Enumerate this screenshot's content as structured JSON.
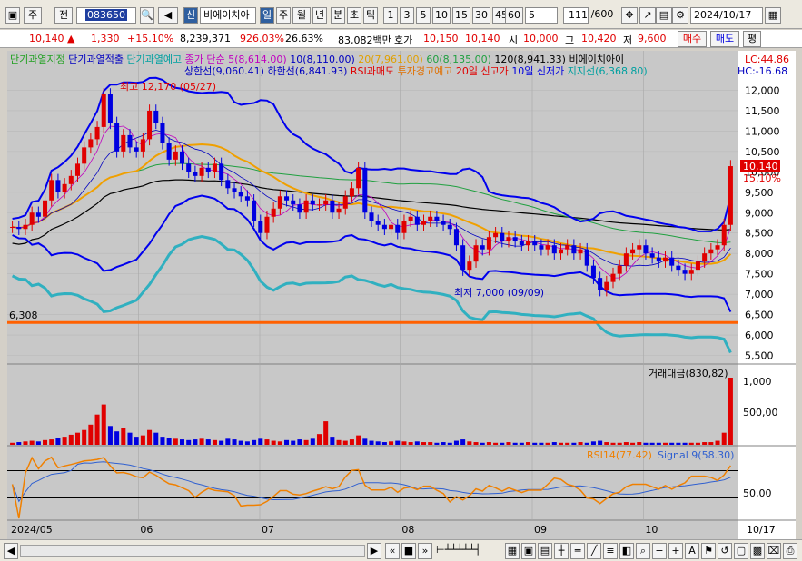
{
  "toolbar": {
    "mode1": "주",
    "mode2": "전",
    "code": "083650",
    "type_badge": "신",
    "stock_name": "비에이치아",
    "periods": [
      "일",
      "주",
      "월",
      "년",
      "분",
      "초",
      "틱"
    ],
    "active_period": "일",
    "numbers": [
      "1",
      "3",
      "5",
      "10",
      "15",
      "30",
      "45",
      "60"
    ],
    "interval_value": "5",
    "count": "111",
    "count_total": "/600",
    "date": "2024/10/17"
  },
  "quote": {
    "price": "10,140",
    "change": "1,330",
    "change_pct": "+15.10%",
    "volume": "8,239,371",
    "vol_ratio": "926.03%",
    "turnover": "26.63%",
    "amount": "83,082백만",
    "bid_label": "호가",
    "bid": "10,150",
    "ask": "10,140",
    "open_label": "시",
    "open": "10,000",
    "high_label": "고",
    "high": "10,420",
    "low_label": "저",
    "low": "9,600",
    "buy_label": "매수",
    "sell_label": "매도",
    "eval_label": "평"
  },
  "legend": {
    "row1": [
      {
        "text": "단기과열지정",
        "color": "#20a020"
      },
      {
        "text": "단기과열적출",
        "color": "#0000c0"
      },
      {
        "text": "단기과열예고",
        "color": "#00a0a0"
      },
      {
        "text": "종가 단순 5(8,614.00)",
        "color": "#c000c0"
      },
      {
        "text": "10(8,110.00)",
        "color": "#0000c0"
      },
      {
        "text": "20(7,961.00)",
        "color": "#e0a000"
      },
      {
        "text": "60(8,135.00)",
        "color": "#20a040"
      },
      {
        "text": "120(8,941.33)",
        "color": "#000000"
      },
      {
        "text": "비에이치아이",
        "color": "#000000"
      }
    ],
    "row2": [
      {
        "text": "상한선(9,060.41)",
        "color": "#0000c0"
      },
      {
        "text": "하한선(6,841.93)",
        "color": "#0000c0"
      },
      {
        "text": "RSI과매도",
        "color": "#e00000"
      },
      {
        "text": "투자경고예고",
        "color": "#e07000"
      },
      {
        "text": "20일 신고가",
        "color": "#e00000"
      },
      {
        "text": "10일 신저가",
        "color": "#0000e0"
      },
      {
        "text": "지지선(6,368.80)",
        "color": "#00a0a0"
      }
    ],
    "lc": "LC:44.86",
    "hc": "HC:-16.68"
  },
  "annotations": {
    "high": "최고 12,170 (05/27)",
    "low": "최저 7,000 (09/09)",
    "support_label": "6,308",
    "price_tag": "10,140",
    "pct_tag": "15.10%"
  },
  "volume_panel": {
    "title": "거래대금(830,82)",
    "ticks": [
      "1,000",
      "500,00"
    ]
  },
  "rsi_panel": {
    "rsi_label": "RSI14(77.42)",
    "signal_label": "Signal 9(58.30)",
    "tick": "50,00"
  },
  "price_axis": [
    "12,000",
    "11,500",
    "11,000",
    "10,500",
    "10,000",
    "9,500",
    "9,000",
    "8,500",
    "8,000",
    "7,500",
    "7,000",
    "6,500",
    "6,000",
    "5,500"
  ],
  "date_axis": [
    "2024/05",
    "06",
    "07",
    "08",
    "09",
    "10",
    "10/17"
  ],
  "colors": {
    "up": "#e00000",
    "down": "#0000e0",
    "bollinger": "#0000ee",
    "support": "#30b0c0",
    "ma20": "#f0a000",
    "ma120": "#000000",
    "ma60": "#20a040",
    "orange_line": "#ff6000"
  },
  "chart_data": {
    "type": "candlestick",
    "ylim": [
      5400,
      12300
    ],
    "close": [
      8650,
      8600,
      8700,
      9000,
      8900,
      9300,
      9800,
      9500,
      9700,
      9900,
      10200,
      10600,
      10800,
      11100,
      11900,
      11200,
      10500,
      10900,
      10600,
      10500,
      10800,
      11500,
      11200,
      10700,
      10300,
      10500,
      10200,
      10000,
      9900,
      10100,
      10000,
      10200,
      9800,
      9600,
      9500,
      9400,
      9300,
      8800,
      8500,
      8900,
      9100,
      9400,
      9300,
      9200,
      9000,
      9300,
      9200,
      9200,
      9300,
      9000,
      9100,
      9400,
      9600,
      10100,
      9000,
      8800,
      8700,
      8600,
      8700,
      8500,
      8800,
      8900,
      8700,
      8800,
      8900,
      8800,
      8700,
      8600,
      8200,
      7600,
      7800,
      8200,
      8100,
      8400,
      8500,
      8300,
      8400,
      8300,
      8200,
      8300,
      8200,
      8100,
      8200,
      8000,
      8100,
      8200,
      8000,
      8100,
      7700,
      7400,
      7100,
      7300,
      7500,
      7700,
      8000,
      8100,
      8200,
      8000,
      7900,
      7800,
      7900,
      7700,
      7600,
      7500,
      7600,
      7800,
      8000,
      8100,
      8200,
      8700,
      10140
    ],
    "volume": [
      3,
      4,
      5,
      6,
      5,
      7,
      8,
      10,
      12,
      15,
      18,
      22,
      30,
      45,
      60,
      28,
      20,
      25,
      18,
      12,
      14,
      22,
      18,
      12,
      10,
      9,
      8,
      7,
      8,
      9,
      8,
      7,
      6,
      9,
      8,
      6,
      5,
      7,
      9,
      8,
      6,
      5,
      7,
      6,
      8,
      7,
      9,
      16,
      35,
      12,
      7,
      6,
      8,
      14,
      9,
      6,
      5,
      4,
      5,
      6,
      5,
      4,
      5,
      4,
      4,
      3,
      4,
      3,
      6,
      8,
      5,
      4,
      3,
      4,
      3,
      3,
      4,
      3,
      3,
      4,
      3,
      3,
      3,
      4,
      3,
      3,
      3,
      4,
      3,
      5,
      6,
      4,
      3,
      3,
      4,
      3,
      4,
      3,
      3,
      3,
      3,
      3,
      3,
      3,
      3,
      3,
      4,
      4,
      6,
      18,
      100
    ]
  }
}
